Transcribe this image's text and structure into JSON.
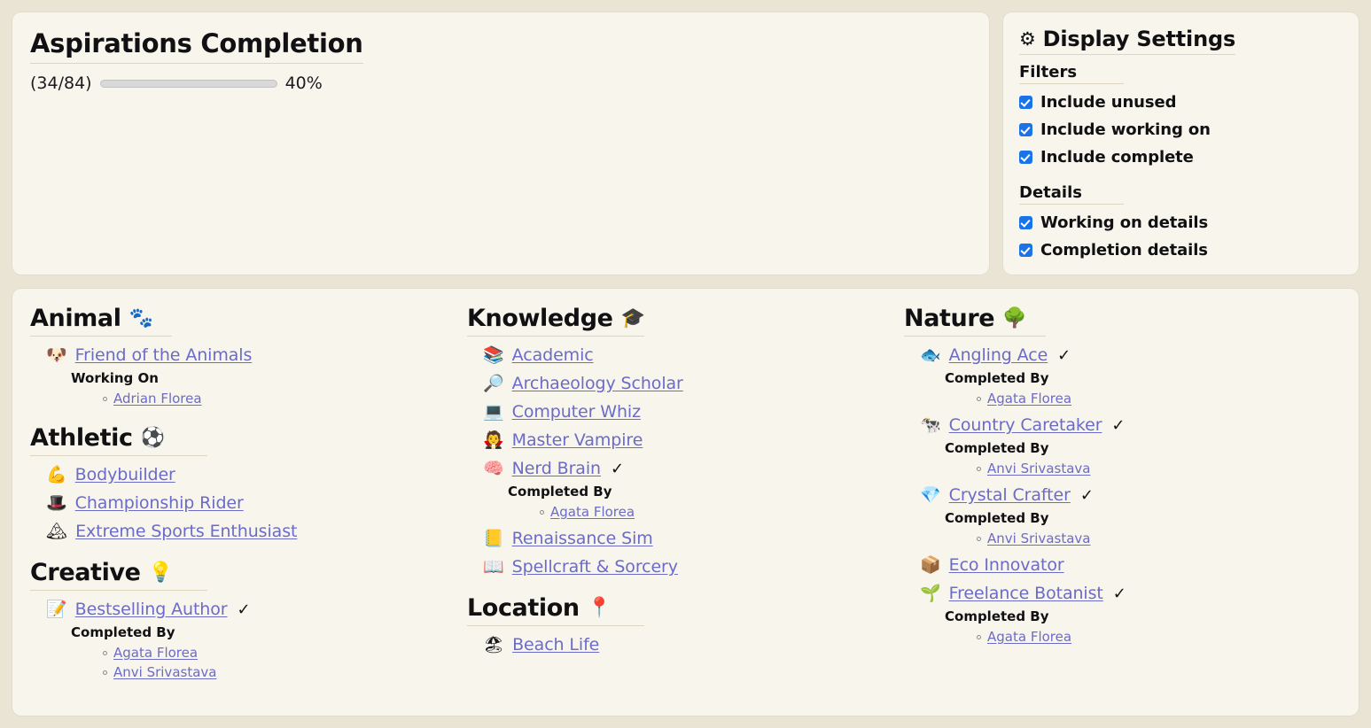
{
  "progress": {
    "title": "Aspirations Completion",
    "fraction": "(34/84)",
    "percent_label": "40%",
    "percent_value": 40,
    "completed": 34,
    "total": 84,
    "fill_color": "#1668dc",
    "track_color": "#d9d9d9"
  },
  "settings": {
    "title": "Display Settings",
    "gear_icon": "⚙",
    "filters_label": "Filters",
    "details_label": "Details",
    "filters": [
      {
        "label": "Include unused",
        "checked": true
      },
      {
        "label": "Include working on",
        "checked": true
      },
      {
        "label": "Include complete",
        "checked": true
      }
    ],
    "details": [
      {
        "label": "Working on details",
        "checked": true
      },
      {
        "label": "Completion details",
        "checked": true
      }
    ],
    "checkbox_color": "#1a73e8"
  },
  "link_color": "#6b6bc8",
  "check_glyph": "✓",
  "columns": [
    {
      "categories": [
        {
          "name": "Animal",
          "emoji": "🐾",
          "items": [
            {
              "icon": "🐶",
              "name": "Friend of the Animals",
              "complete": false,
              "detail_label": "Working On",
              "sims": [
                "Adrian Florea"
              ]
            }
          ]
        },
        {
          "name": "Athletic",
          "emoji": "⚽",
          "items": [
            {
              "icon": "💪",
              "name": "Bodybuilder",
              "complete": false,
              "detail_label": "",
              "sims": []
            },
            {
              "icon": "🎩",
              "name": "Championship Rider",
              "complete": false,
              "detail_label": "",
              "sims": []
            },
            {
              "icon": "🏔",
              "name": "Extreme Sports Enthusiast",
              "complete": false,
              "detail_label": "",
              "sims": []
            }
          ]
        },
        {
          "name": "Creative",
          "emoji": "💡",
          "items": [
            {
              "icon": "📝",
              "name": "Bestselling Author",
              "complete": true,
              "detail_label": "Completed By",
              "sims": [
                "Agata Florea",
                "Anvi Srivastava"
              ]
            }
          ]
        }
      ]
    },
    {
      "categories": [
        {
          "name": "Knowledge",
          "emoji": "🎓",
          "items": [
            {
              "icon": "📚",
              "name": "Academic",
              "complete": false,
              "detail_label": "",
              "sims": []
            },
            {
              "icon": "🔎",
              "name": "Archaeology Scholar",
              "complete": false,
              "detail_label": "",
              "sims": []
            },
            {
              "icon": "💻",
              "name": "Computer Whiz",
              "complete": false,
              "detail_label": "",
              "sims": []
            },
            {
              "icon": "🧛",
              "name": "Master Vampire",
              "complete": false,
              "detail_label": "",
              "sims": []
            },
            {
              "icon": "🧠",
              "name": "Nerd Brain",
              "complete": true,
              "detail_label": "Completed By",
              "sims": [
                "Agata Florea"
              ]
            },
            {
              "icon": "📒",
              "name": "Renaissance Sim",
              "complete": false,
              "detail_label": "",
              "sims": []
            },
            {
              "icon": "📖",
              "name": "Spellcraft & Sorcery",
              "complete": false,
              "detail_label": "",
              "sims": []
            }
          ]
        },
        {
          "name": "Location",
          "emoji": "📍",
          "items": [
            {
              "icon": "🏖",
              "name": "Beach Life",
              "complete": false,
              "detail_label": "",
              "sims": []
            }
          ]
        }
      ]
    },
    {
      "categories": [
        {
          "name": "Nature",
          "emoji": "🌳",
          "items": [
            {
              "icon": "🐟",
              "name": "Angling Ace",
              "complete": true,
              "detail_label": "Completed By",
              "sims": [
                "Agata Florea"
              ]
            },
            {
              "icon": "🐄",
              "name": "Country Caretaker",
              "complete": true,
              "detail_label": "Completed By",
              "sims": [
                "Anvi Srivastava"
              ]
            },
            {
              "icon": "💎",
              "name": "Crystal Crafter",
              "complete": true,
              "detail_label": "Completed By",
              "sims": [
                "Anvi Srivastava"
              ]
            },
            {
              "icon": "📦",
              "name": "Eco Innovator",
              "complete": false,
              "detail_label": "",
              "sims": []
            },
            {
              "icon": "🌱",
              "name": "Freelance Botanist",
              "complete": true,
              "detail_label": "Completed By",
              "sims": [
                "Agata Florea"
              ]
            }
          ]
        }
      ]
    }
  ]
}
